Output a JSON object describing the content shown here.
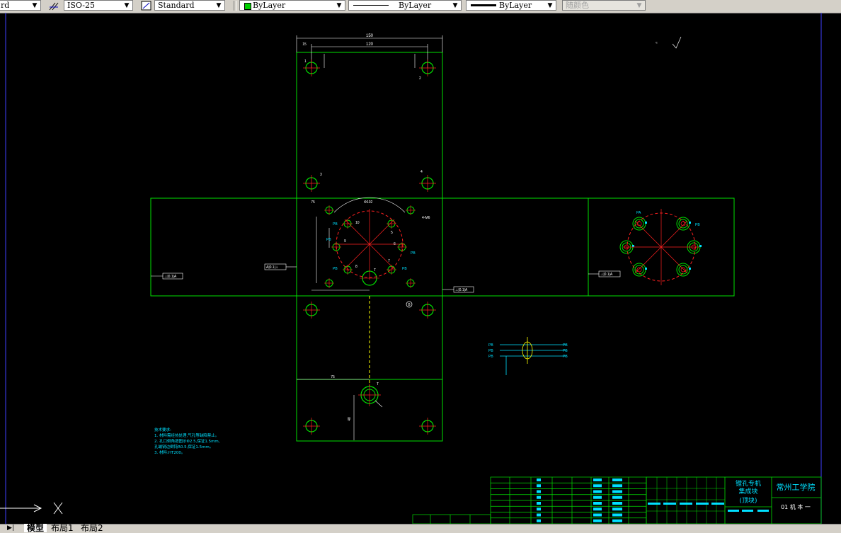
{
  "toolbar": {
    "text_style": "rd",
    "dim_style": "ISO-25",
    "table_style": "Standard",
    "layer_color": "ByLayer",
    "linetype": "ByLayer",
    "lineweight": "ByLayer",
    "plot_style": "随颜色",
    "accent_green": "#00d000"
  },
  "tabs": [
    "模型",
    "布局1",
    "布局2"
  ],
  "drawing": {
    "dims": {
      "top_overall": "150",
      "top_inner": "120",
      "left_offset": "15",
      "left_side": "75",
      "bottom_75": "75",
      "height_48": "48",
      "dim_4_m6": "4-M6",
      "dim_circle": "Φ102"
    },
    "hole_numbers": [
      "1",
      "2",
      "3",
      "4",
      "5",
      "6",
      "7",
      "8",
      "9",
      "10",
      "T"
    ],
    "port_labels": [
      "PB",
      "PB",
      "PB",
      "PB",
      "PB",
      "PA",
      "PB"
    ],
    "symbol_t": "T",
    "symbol_b": "B",
    "tolerance_1": "⊥|0.1|A",
    "tolerance_2": "A|0.1|⊥",
    "tolerance_3": "⊥|0.1|A",
    "tolerance_4": "⊥|0.1|A",
    "notes_title": "技术要求:",
    "notes": [
      "1. 材料需经热处理,气孔等缺陷禁止。",
      "2. 孔口倒角按图示Φ2.5,保证1.5mm,",
      "   孔端锐边倒钝R0.5,保证1.5mm。",
      "3. 材料:HT200。"
    ]
  },
  "title_block": {
    "title_line1": "镗孔专机",
    "title_line2": "集成块",
    "title_line3": "(顶块)",
    "school": "常州工学院",
    "drawing_no": "01 机 本 一"
  }
}
